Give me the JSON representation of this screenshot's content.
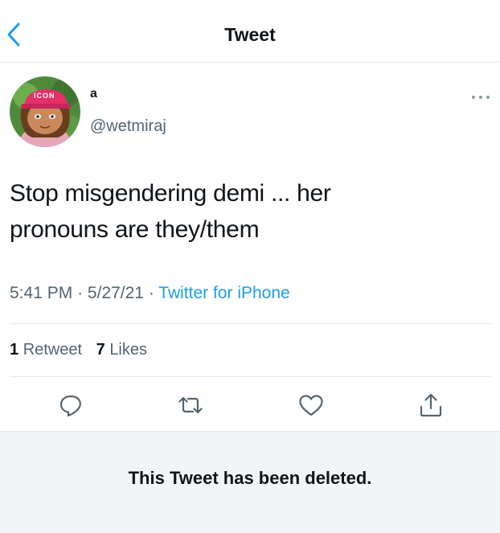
{
  "nav": {
    "title": "Tweet"
  },
  "author": {
    "display_name": "a",
    "handle": "@wetmiraj",
    "avatar_cap_text": "ICON"
  },
  "tweet": {
    "text_line1": "Stop misgendering demi ... her",
    "text_line2": "pronouns are they/them",
    "time": "5:41 PM",
    "date": "5/27/21",
    "source": "Twitter for iPhone",
    "dot": "·"
  },
  "stats": {
    "retweets": "1",
    "retweets_label": "Retweet",
    "likes": "7",
    "likes_label": "Likes"
  },
  "actions": [
    "reply-icon",
    "retweet-icon",
    "like-icon",
    "share-icon"
  ],
  "notice": {
    "text": "This Tweet has been deleted."
  },
  "colors": {
    "accent": "#1d9bf0",
    "muted": "#536471",
    "text": "#0f1419",
    "banner_bg": "#f3f4f6"
  }
}
